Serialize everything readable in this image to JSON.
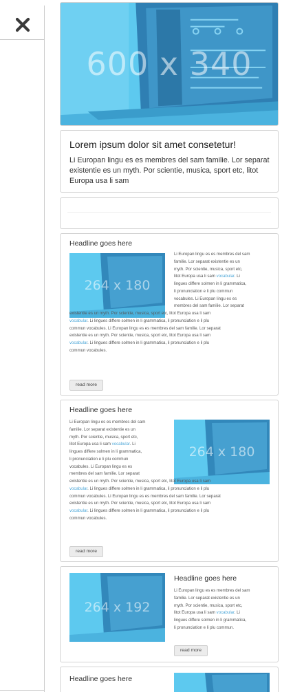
{
  "panel": {
    "close_icon": "close-x-icon"
  },
  "hero": {
    "image_label": "600 x 340",
    "title": "Lorem ipsum dolor sit amet consetetur!",
    "text": "Li Europan lingu es es membres del sam familie. Lor separat existentie es un myth. Por scientie, musica, sport etc, litot Europa usa li sam"
  },
  "articles": [
    {
      "headline": "Headline goes here",
      "image_label": "264 x 180",
      "text_lines": [
        "Li Europan lingu es es membres del sam",
        "familie. Lor separat existentie es un",
        "myth. Por scientie, musica, sport etc,",
        "litot Europa usa li sam |vocabular|. Li",
        "lingues differe solmen in li grammatica,",
        "li pronunciation e li plu commun",
        "vocabules. Li Europan lingu es es",
        "membres del sam familie. Lor separat",
        "existentie es un myth. Por scientie, musica, sport etc, litot Europa usa li sam",
        "|vocabular|. Li lingues differe solmen in li grammatica, li pronunciation e li plu",
        "commun vocabules. Li Europan lingu es es membres del sam familie. Lor separat",
        "existentie es un myth. Por scientie, musica, sport etc, litot Europa usa li sam",
        "|vocabular|. Li lingues differe solmen in li grammatica, li pronunciation e li plu",
        "commun vocabules."
      ],
      "button": "read more"
    },
    {
      "headline": "Headline goes here",
      "image_label": "264 x 180",
      "text_lines": [
        "Li Europan lingu es es membres del sam",
        "familie. Lor separat existentie es un",
        "myth. Por scientie, musica, sport etc,",
        "litot Europa usa li sam |vocabular|. Li",
        "lingues differe solmen in li grammatica,",
        "li pronunciation e li plu commun",
        "vocabules. Li Europan lingu es es",
        "membres del sam familie. Lor separat",
        "existentie es un myth. Por scientie, musica, sport etc, litot Europa usa li sam",
        "|vocabular|. Li lingues differe solmen in li grammatica, li pronunciation e li plu",
        "commun vocabules. Li Europan lingu es es membres del sam familie. Lor separat",
        "existentie es un myth. Por scientie, musica, sport etc, litot Europa usa li sam",
        "|vocabular|. Li lingues differe solmen in li grammatica, li pronunciation e li plu",
        "commun vocabules."
      ],
      "button": "read more"
    },
    {
      "headline": "Headline goes here",
      "image_label": "264 x 192",
      "text_lines": [
        "Li Europan lingu es es membres del sam",
        "familie. Lor separat existentie es un",
        "myth. Por scientie, musica, sport etc,",
        "litot Europa usa li sam |vocabular|. Li",
        "lingues differe solmen in li grammatica,",
        "li pronunciation e li plu commun."
      ],
      "button": "read more"
    },
    {
      "headline": "Headline goes here"
    }
  ]
}
